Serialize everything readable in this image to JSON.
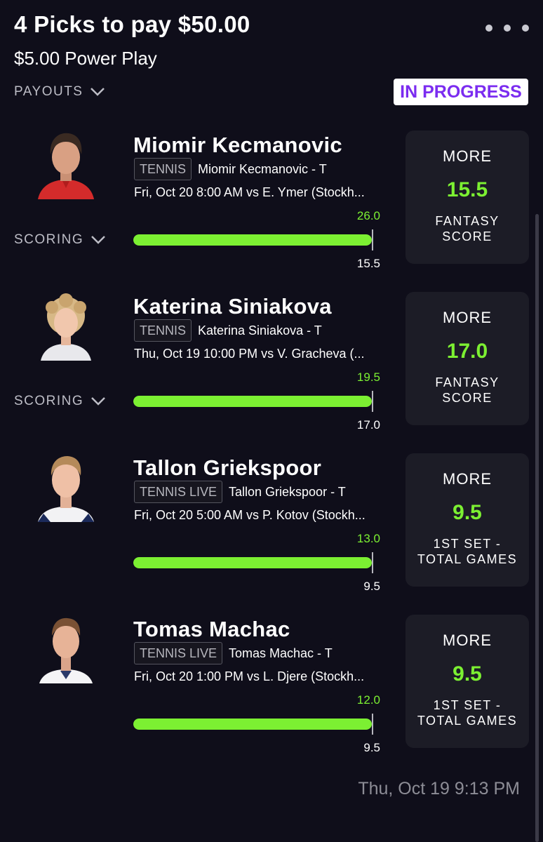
{
  "header": {
    "title": "4 Picks to pay $50.00",
    "subtitle": "$5.00 Power Play",
    "payouts_label": "PAYOUTS",
    "status": "IN PROGRESS",
    "menu_icon": "more-horizontal-icon"
  },
  "colors": {
    "background": "#0f0e1a",
    "accent_green": "#7cf032",
    "status_purple": "#7b2cf0",
    "card_bg": "#1c1c26"
  },
  "picks": [
    {
      "player": "Miomir Kecmanovic",
      "sport_tag": "TENNIS",
      "tag_player": "Miomir Kecmanovic - T",
      "game": "Fri, Oct 20 8:00 AM  vs E. Ymer (Stockh...",
      "scoring_label": "SCORING",
      "actual": "26.0",
      "line": "15.5",
      "progress": 1.0,
      "direction": "MORE",
      "line_value": "15.5",
      "stat": "FANTASY SCORE"
    },
    {
      "player": "Katerina Siniakova",
      "sport_tag": "TENNIS",
      "tag_player": "Katerina Siniakova - T",
      "game": "Thu, Oct 19 10:00 PM  vs V. Gracheva (...",
      "scoring_label": "SCORING",
      "actual": "19.5",
      "line": "17.0",
      "progress": 1.0,
      "direction": "MORE",
      "line_value": "17.0",
      "stat": "FANTASY SCORE"
    },
    {
      "player": "Tallon Griekspoor",
      "sport_tag": "TENNIS LIVE",
      "tag_player": "Tallon Griekspoor - T",
      "game": "Fri, Oct 20 5:00 AM  vs P. Kotov (Stockh...",
      "scoring_label": "",
      "actual": "13.0",
      "line": "9.5",
      "progress": 1.0,
      "direction": "MORE",
      "line_value": "9.5",
      "stat": "1ST SET - TOTAL GAMES"
    },
    {
      "player": "Tomas Machac",
      "sport_tag": "TENNIS LIVE",
      "tag_player": "Tomas Machac - T",
      "game": "Fri, Oct 20 1:00 PM  vs L. Djere (Stockh...",
      "scoring_label": "",
      "actual": "12.0",
      "line": "9.5",
      "progress": 1.0,
      "direction": "MORE",
      "line_value": "9.5",
      "stat": "1ST SET - TOTAL GAMES"
    }
  ],
  "footer": {
    "timestamp": "Thu, Oct 19 9:13 PM"
  }
}
